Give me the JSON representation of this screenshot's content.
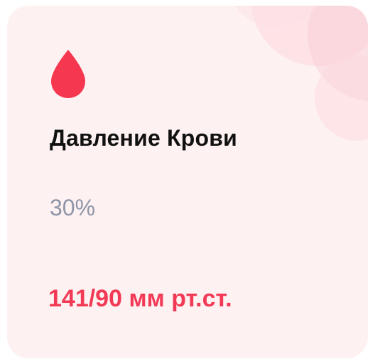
{
  "card": {
    "icon": "blood-drop-icon",
    "title": "Давление Крови",
    "percent": "30%",
    "value": "141/90 мм рт.ст."
  },
  "colors": {
    "accent": "#f23a56",
    "drop": "#f5374f",
    "card_background": "#fef1f2",
    "title": "#111111",
    "muted": "#8e95a8",
    "decoration": "#fbd6dc"
  }
}
